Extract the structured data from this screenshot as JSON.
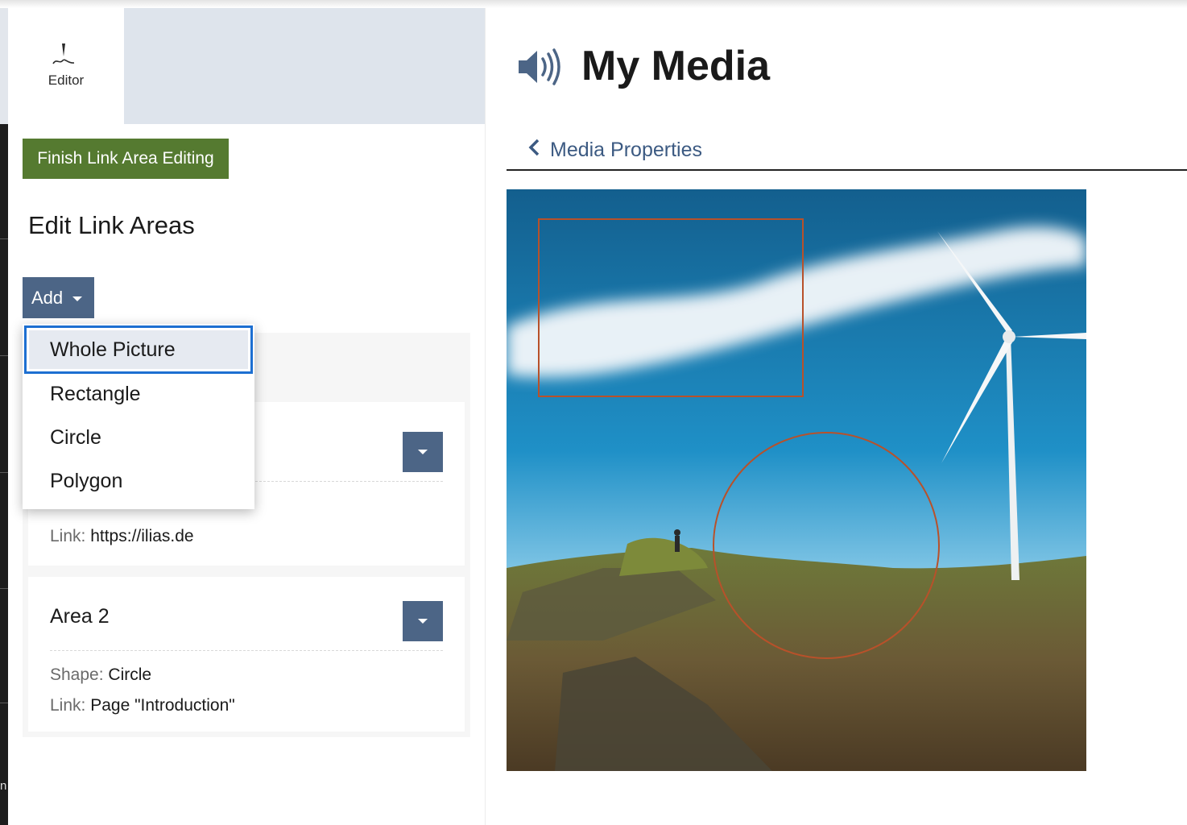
{
  "slate": {
    "tab": {
      "label": "Editor",
      "icon": "pen-icon"
    },
    "finish_button": "Finish Link Area Editing",
    "heading": "Edit Link Areas",
    "add_button": "Add",
    "add_menu": {
      "items": [
        "Whole Picture",
        "Rectangle",
        "Circle",
        "Polygon"
      ],
      "selected": "Whole Picture"
    },
    "areas": [
      {
        "link_label": "Link:",
        "link_value": "https://ilias.de"
      },
      {
        "title": "Area 2",
        "shape_label": "Shape:",
        "shape_value": "Circle",
        "link_label": "Link:",
        "link_value": "Page \"Introduction\""
      }
    ]
  },
  "main": {
    "title": "My Media",
    "title_icon": "speaker-icon",
    "back_link": "Media Properties",
    "image": {
      "subject": "wind-turbine-landscape",
      "link_areas": [
        "rectangle",
        "circle"
      ],
      "area_outline_color": "#b8512a"
    }
  },
  "colors": {
    "primary": "#4c6586",
    "success": "#557a30",
    "focus": "#1d6fd1",
    "link": "#3c5a82"
  }
}
